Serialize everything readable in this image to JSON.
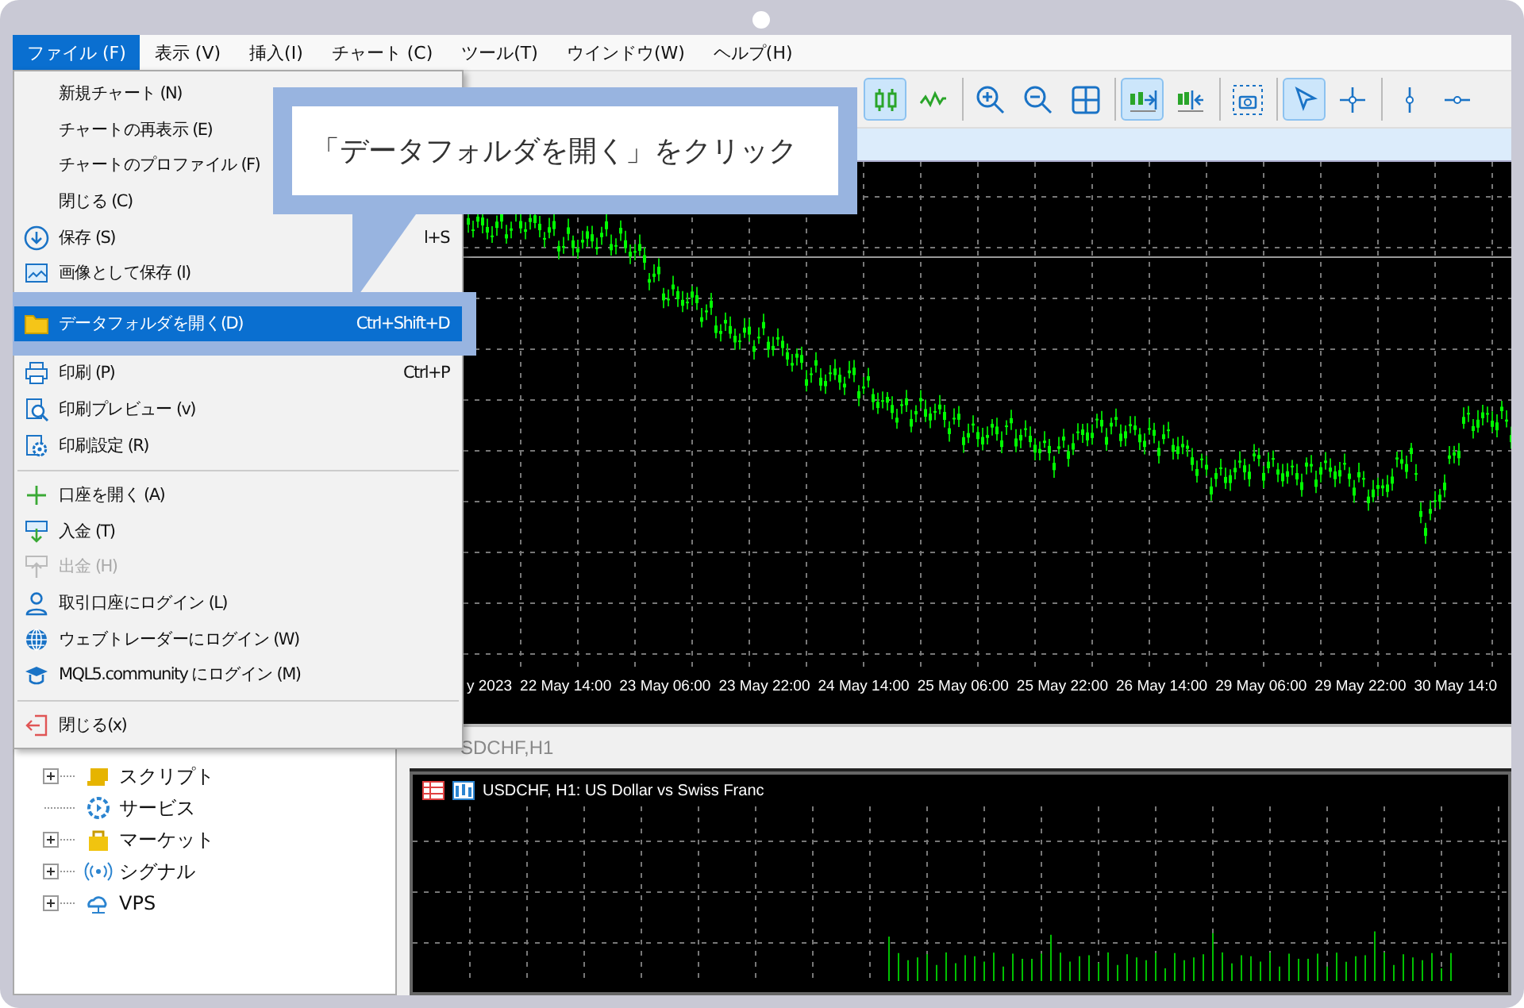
{
  "menubar": [
    {
      "label": "ファイル (F)",
      "selected": true
    },
    {
      "label": "表示 (V)",
      "selected": false
    },
    {
      "label": "挿入(I)",
      "selected": false
    },
    {
      "label": "チャート (C)",
      "selected": false
    },
    {
      "label": "ツール(T)",
      "selected": false
    },
    {
      "label": "ウインドウ(W)",
      "selected": false
    },
    {
      "label": "ヘルプ(H)",
      "selected": false
    }
  ],
  "toolbar": {
    "groups": [
      [
        {
          "kind": "candles",
          "selected": true
        },
        {
          "kind": "line",
          "selected": false
        }
      ],
      [
        {
          "kind": "zoom-in",
          "selected": false
        },
        {
          "kind": "zoom-out",
          "selected": false
        },
        {
          "kind": "grid",
          "selected": false
        }
      ],
      [
        {
          "kind": "autoscroll",
          "selected": true
        },
        {
          "kind": "shift",
          "selected": false
        }
      ],
      [
        {
          "kind": "screenshot",
          "selected": false
        }
      ],
      [
        {
          "kind": "cursor",
          "selected": true
        },
        {
          "kind": "crosshair",
          "selected": false
        }
      ],
      [
        {
          "kind": "vline",
          "selected": false
        },
        {
          "kind": "hline",
          "selected": false
        }
      ]
    ]
  },
  "file_menu": {
    "groups": [
      [
        {
          "kind": "none",
          "label": "新規チャート (N)",
          "disabled": false,
          "selected": false
        },
        {
          "kind": "none",
          "label": "チャートの再表示 (E)",
          "disabled": false,
          "selected": false
        },
        {
          "kind": "none",
          "label": "チャートのプロファイル (F)",
          "disabled": false,
          "selected": false
        },
        {
          "kind": "none",
          "label": "閉じる (C)",
          "disabled": false,
          "selected": false
        },
        {
          "kind": "save",
          "label": "保存 (S)",
          "shortcut": "l+S",
          "disabled": false,
          "selected": false
        },
        {
          "kind": "image",
          "label": "画像として保存 (I)",
          "disabled": false,
          "selected": false
        }
      ],
      [
        {
          "kind": "folder",
          "label": "データフォルダを開く(D)",
          "shortcut": "Ctrl+Shift+D",
          "disabled": false,
          "selected": true
        }
      ],
      [
        {
          "kind": "print",
          "label": "印刷 (P)",
          "shortcut": "Ctrl+P",
          "disabled": false,
          "selected": false
        },
        {
          "kind": "preview",
          "label": "印刷プレビュー (v)",
          "disabled": false,
          "selected": false
        },
        {
          "kind": "settings",
          "label": "印刷設定 (R)",
          "disabled": false,
          "selected": false
        }
      ],
      [
        {
          "kind": "plus",
          "label": "口座を開く (A)",
          "disabled": false,
          "selected": false
        },
        {
          "kind": "deposit",
          "label": "入金 (T)",
          "disabled": false,
          "selected": false
        },
        {
          "kind": "withdraw",
          "label": "出金 (H)",
          "disabled": true,
          "selected": false
        },
        {
          "kind": "user",
          "label": "取引口座にログイン (L)",
          "disabled": false,
          "selected": false
        },
        {
          "kind": "globe",
          "label": "ウェブトレーダーにログイン (W)",
          "disabled": false,
          "selected": false
        },
        {
          "kind": "cap",
          "label": "MQL5.community にログイン (M)",
          "disabled": false,
          "selected": false
        }
      ],
      [
        {
          "kind": "exit",
          "label": "閉じる(x)",
          "disabled": false,
          "selected": false
        }
      ]
    ]
  },
  "callout": {
    "text": "「データフォルダを開く」をクリック"
  },
  "chart_1": {
    "time_axis": [
      "y 2023",
      "22 May 14:00",
      "23 May 06:00",
      "23 May 22:00",
      "24 May 14:00",
      "25 May 06:00",
      "25 May 22:00",
      "26 May 14:00",
      "29 May 06:00",
      "29 May 22:00",
      "30 May 14:0"
    ]
  },
  "chart_2": {
    "window_title": "SDCHF,H1",
    "header": "USDCHF, H1:  US Dollar vs Swiss Franc"
  },
  "navigator": {
    "items": [
      {
        "kind": "script",
        "label": "スクリプト",
        "expandable": true
      },
      {
        "kind": "service",
        "label": "サービス",
        "expandable": false
      },
      {
        "kind": "market",
        "label": "マーケット",
        "expandable": true
      },
      {
        "kind": "signal",
        "label": "シグナル",
        "expandable": true
      },
      {
        "kind": "vps",
        "label": "VPS",
        "expandable": true
      }
    ]
  }
}
